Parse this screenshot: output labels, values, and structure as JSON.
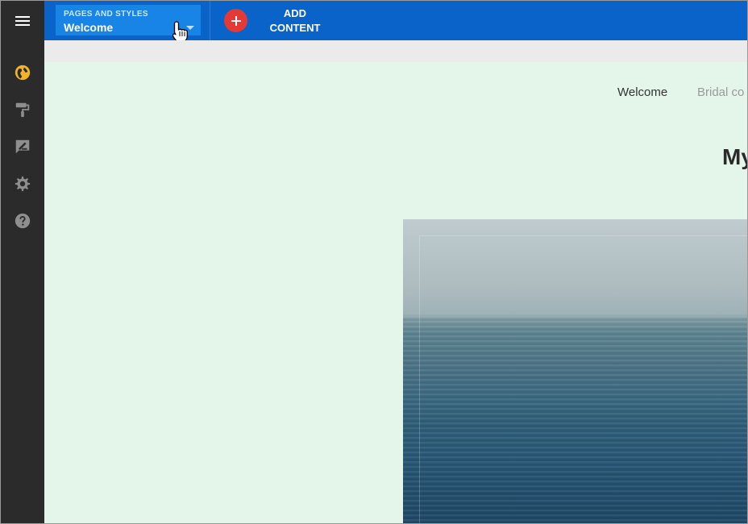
{
  "topbar": {
    "pages_dropdown": {
      "caption": "PAGES AND STYLES",
      "value": "Welcome"
    },
    "add_content": {
      "line1": "ADD",
      "line2": "CONTENT"
    }
  },
  "rail": {
    "items": [
      {
        "name": "globe-icon",
        "color": "#f0b429"
      },
      {
        "name": "paint-roller-icon",
        "color": "#8e8e8e"
      },
      {
        "name": "edit-note-icon",
        "color": "#8e8e8e"
      },
      {
        "name": "gear-icon",
        "color": "#8e8e8e"
      },
      {
        "name": "help-icon",
        "color": "#8e8e8e"
      }
    ]
  },
  "site": {
    "nav": [
      "Welcome",
      "Bridal co"
    ],
    "title": "My"
  },
  "colors": {
    "topbar": "#0a63c9",
    "dropdown": "#1784e6",
    "add": "#e53935",
    "rail": "#2b2b2b",
    "canvas": "#e4f5ea"
  }
}
